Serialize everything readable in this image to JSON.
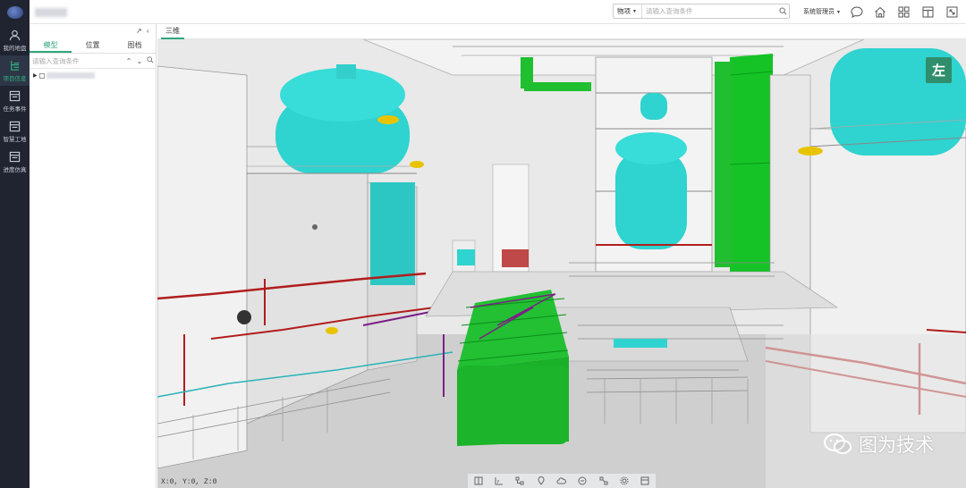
{
  "nav": {
    "items": [
      {
        "label": "我的地盘",
        "icon": "user-icon"
      },
      {
        "label": "项目信息",
        "icon": "structure-icon",
        "active": true
      },
      {
        "label": "任务事件",
        "icon": "task-icon"
      },
      {
        "label": "智慧工地",
        "icon": "site-icon"
      },
      {
        "label": "进度仿真",
        "icon": "schedule-icon"
      }
    ]
  },
  "topbar": {
    "search_type": "物项",
    "search_placeholder": "请输入查询条件",
    "user": "系统管理员"
  },
  "panel": {
    "tabs": [
      "模型",
      "位置",
      "图档"
    ],
    "active_tab": "模型",
    "search_placeholder": "请输入查询条件"
  },
  "viewport": {
    "tab": "三维",
    "view_label": "左",
    "coords": "X:0, Y:0, Z:0",
    "watermark": "图为技术"
  },
  "colors": {
    "accent": "#2fa77a",
    "nav_bg": "#1f2430"
  }
}
